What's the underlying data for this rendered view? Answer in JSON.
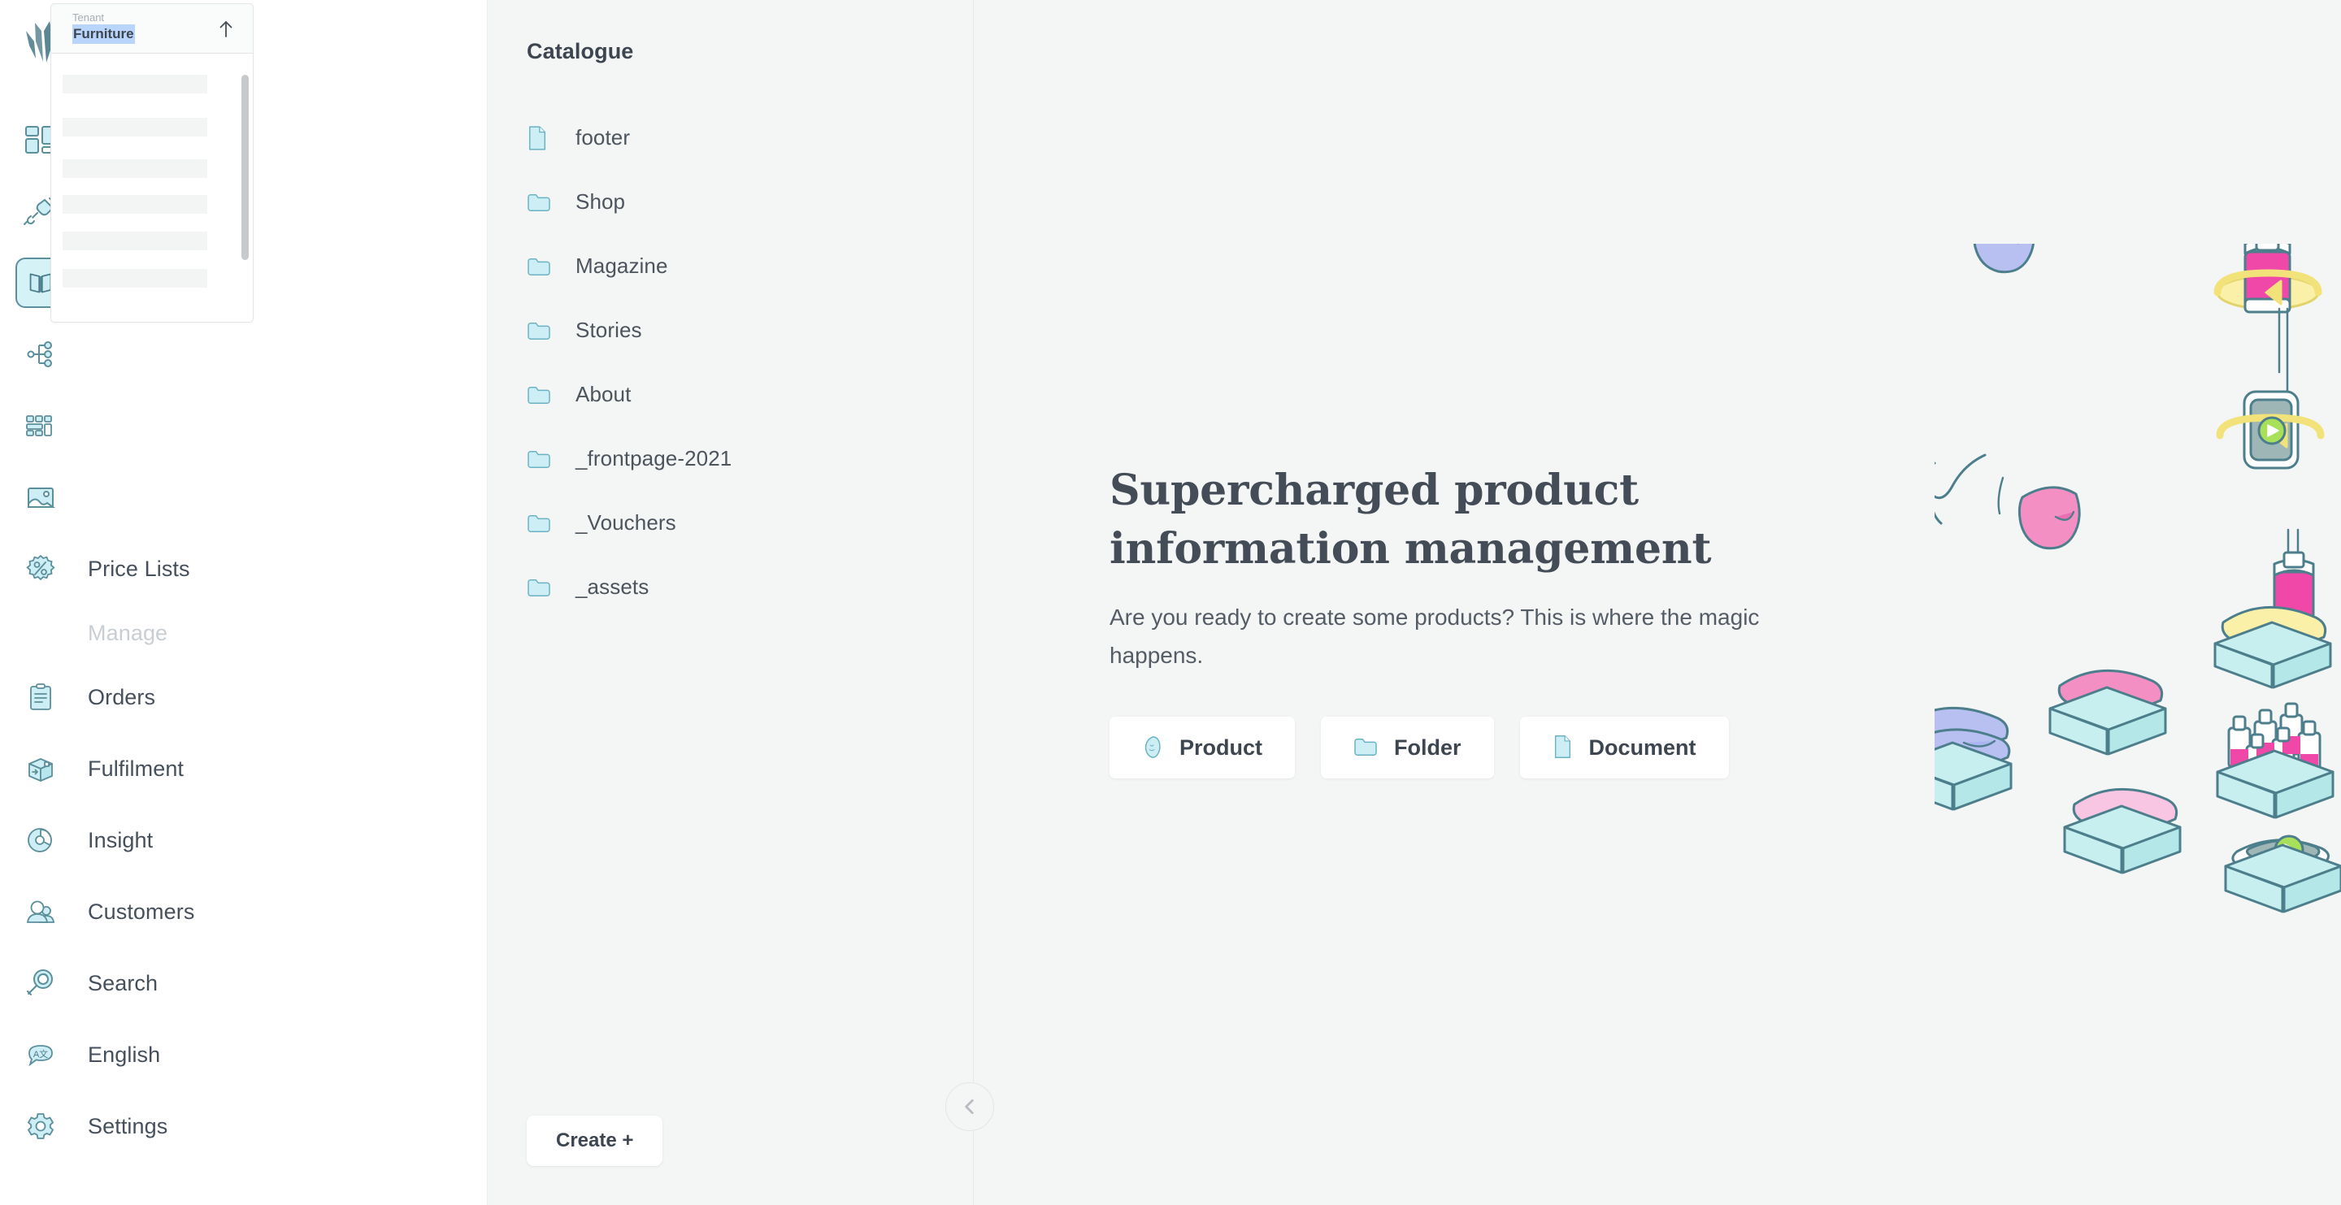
{
  "brand": {
    "logo_icon": "crystalize-logo-icon",
    "accent": "#3d4650",
    "icon_fill": "#cdeef5",
    "icon_stroke": "#5b8f9b"
  },
  "tenant_popover": {
    "kicker": "Tenant",
    "name": "Furniture",
    "arrow_icon": "arrow-up-icon",
    "skeleton_rows": 6
  },
  "rail": {
    "items": [
      {
        "label": "",
        "icon": "dashboard-icon",
        "active": false,
        "has_label": false
      },
      {
        "label": "",
        "icon": "plug-connect-icon",
        "active": false,
        "has_label": false
      },
      {
        "label": "",
        "icon": "catalogue-book-icon",
        "active": true,
        "has_label": false
      },
      {
        "label": "",
        "icon": "topology-tree-icon",
        "active": false,
        "has_label": false
      },
      {
        "label": "",
        "icon": "grid-blocks-icon",
        "active": false,
        "has_label": false
      },
      {
        "label": "",
        "icon": "image-picture-icon",
        "active": false,
        "has_label": false
      },
      {
        "label": "Price Lists",
        "icon": "discount-badge-icon",
        "active": false,
        "has_label": true
      },
      {
        "label": "Manage",
        "icon": "",
        "active": false,
        "has_label": true,
        "muted": true
      },
      {
        "label": "Orders",
        "icon": "clipboard-orders-icon",
        "active": false,
        "has_label": true
      },
      {
        "label": "Fulfilment",
        "icon": "box-fulfilment-icon",
        "active": false,
        "has_label": true
      },
      {
        "label": "Insight",
        "icon": "pie-chart-icon",
        "active": false,
        "has_label": true
      },
      {
        "label": "Customers",
        "icon": "people-customers-icon",
        "active": false,
        "has_label": true
      },
      {
        "label": "Search",
        "icon": "magnifier-search-icon",
        "active": false,
        "has_label": true
      },
      {
        "label": "English",
        "icon": "language-bubble-icon",
        "active": false,
        "has_label": true
      },
      {
        "label": "Settings",
        "icon": "gear-settings-icon",
        "active": false,
        "has_label": true
      }
    ]
  },
  "catalogue": {
    "title": "Catalogue",
    "create_label": "Create +",
    "collapse_icon": "chevron-left-icon",
    "items": [
      {
        "label": "footer",
        "icon": "document-icon",
        "type": "document"
      },
      {
        "label": "Shop",
        "icon": "folder-icon",
        "type": "folder"
      },
      {
        "label": "Magazine",
        "icon": "folder-icon",
        "type": "folder"
      },
      {
        "label": "Stories",
        "icon": "folder-icon",
        "type": "folder"
      },
      {
        "label": "About",
        "icon": "folder-icon",
        "type": "folder"
      },
      {
        "label": "_frontpage-2021",
        "icon": "folder-icon",
        "type": "folder"
      },
      {
        "label": "_Vouchers",
        "icon": "folder-icon",
        "type": "folder"
      },
      {
        "label": "_assets",
        "icon": "folder-icon",
        "type": "folder"
      }
    ]
  },
  "hero": {
    "heading_line1": "Supercharged product",
    "heading_line2": "information management",
    "subtitle": "Are you ready to create some products? This is where the magic happens.",
    "buttons": [
      {
        "label": "Product",
        "icon": "product-shape-icon"
      },
      {
        "label": "Folder",
        "icon": "folder-icon"
      },
      {
        "label": "Document",
        "icon": "document-icon"
      }
    ]
  },
  "illustration": {
    "name": "product-boxes-illustration",
    "colors": {
      "outline": "#4c7e8c",
      "box": "#c8efef",
      "pink": "#f48fc4",
      "lightpink": "#f8c6e2",
      "blue": "#b8c0f2",
      "yellow": "#fbf0a8",
      "green": "#a8e05a",
      "grey": "#9fb6b6"
    }
  }
}
